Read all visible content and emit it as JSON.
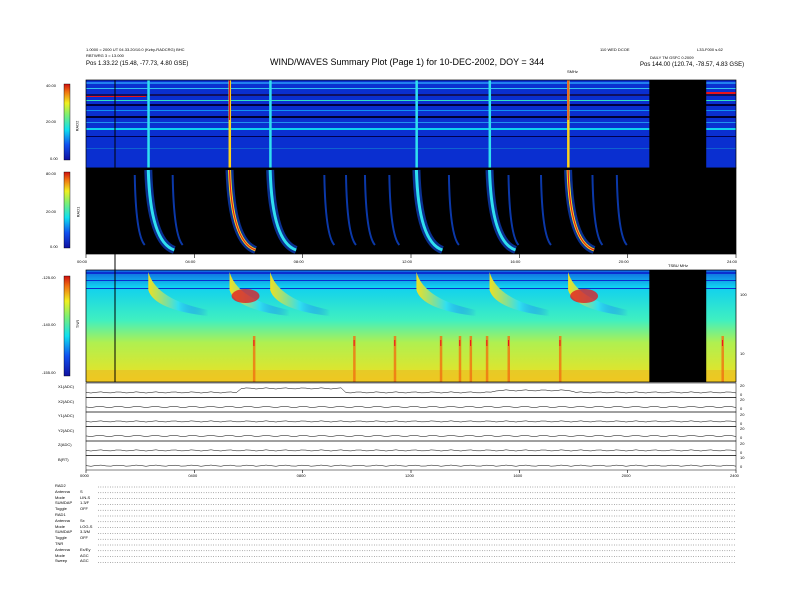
{
  "header": {
    "title": "WIND/WAVES Summary Plot (Page 1) for 10-DEC-2002, DOY = 344",
    "left_line1": "1.0000 = 2000 UT 04.33.20/10.0 (Kzby-RADCRG) BHC",
    "left_line2": "RBTWRG 3 = 13.000",
    "left_line3": "Pos   1.33.22 (15.48, -77.73, 4.80 GSE)",
    "right_line1": "110 WED DCOE",
    "right_line2": "L33-F000  s.62",
    "right_line3": "DAILY TM GSFC 0.2009",
    "right_line4": "Pos   144.00 (120.74, -78.57, 4.83 GSE)"
  },
  "panels": {
    "rad2": {
      "label": "RAD2",
      "ticks": [
        "40.00",
        "20.00",
        "0.00"
      ]
    },
    "rad1": {
      "label": "RAD1",
      "ticks": [
        "80.00",
        "20.00",
        "0.00"
      ]
    },
    "tnr": {
      "label": "TNR",
      "ticks": [
        "-125.00",
        "-140.00",
        "-155.00"
      ],
      "right_ticks": [
        "100",
        "10"
      ]
    },
    "corner_label": "SMHz",
    "tnr_corner": "TSBU MHz"
  },
  "time_axis": [
    "00:00",
    "04:00",
    "08:00",
    "12:00",
    "16:00",
    "20:00",
    "24:00"
  ],
  "bottom_axis": [
    "0000",
    "0400",
    "0800",
    "1200",
    "1600",
    "2000",
    "2400"
  ],
  "housekeeping": [
    {
      "label": "X1(ADC)",
      "ticks": [
        "20",
        "0"
      ]
    },
    {
      "label": "X2(ADC)",
      "ticks": [
        "20",
        "0"
      ]
    },
    {
      "label": "Y1(ADC)",
      "ticks": [
        "20",
        "0"
      ]
    },
    {
      "label": "Y2(ADC)",
      "ticks": [
        "20",
        "0"
      ]
    },
    {
      "label": "Z(ADC)",
      "ticks": [
        "20",
        "0"
      ]
    },
    {
      "label": "B(RT)",
      "ticks": [
        "10",
        "0"
      ]
    }
  ],
  "settings": [
    {
      "name": "RAD2",
      "value": ""
    },
    {
      "name": "Antenna",
      "value": "S"
    },
    {
      "name": "Mode",
      "value": "LIN-S"
    },
    {
      "name": "SUMDAP",
      "value": "1.3/F"
    },
    {
      "name": "Toggle",
      "value": "OFF"
    },
    {
      "name": "RAD1",
      "value": ""
    },
    {
      "name": "Antenna",
      "value": "Sx"
    },
    {
      "name": "Mode",
      "value": "LOG-S"
    },
    {
      "name": "SUMDAP",
      "value": "3.3/M"
    },
    {
      "name": "Toggle",
      "value": "OFF"
    },
    {
      "name": "TNR",
      "value": ""
    },
    {
      "name": "Antenna",
      "value": "Ex/Ey"
    },
    {
      "name": "Mode",
      "value": "AGC"
    },
    {
      "name": "Sweep",
      "value": "AGC"
    }
  ],
  "colors": {
    "bg_blue": "#0a2fd0",
    "black": "#000000",
    "red": "#e8141c",
    "yellow": "#ffd21c",
    "cyan": "#1ae8f0"
  },
  "chart_data": {
    "type": "heatmap",
    "title": "WIND/WAVES Summary Plot (Page 1) for 10-DEC-2002, DOY = 344",
    "x": {
      "unit": "hours UT",
      "range": [
        0,
        24
      ]
    },
    "rad2": {
      "ylim": [
        0,
        40
      ],
      "ylabel": "RAD2"
    },
    "rad1": {
      "ylim": [
        0,
        80
      ],
      "ylabel": "RAD1"
    },
    "tnr": {
      "ylim": [
        -155,
        -125
      ],
      "ylabel": "TNR"
    },
    "bursts_hours": [
      2.3,
      5.3,
      6.8,
      12.2,
      14.9,
      17.8
    ],
    "data_gap_hours": [
      20.8,
      22.9
    ]
  }
}
